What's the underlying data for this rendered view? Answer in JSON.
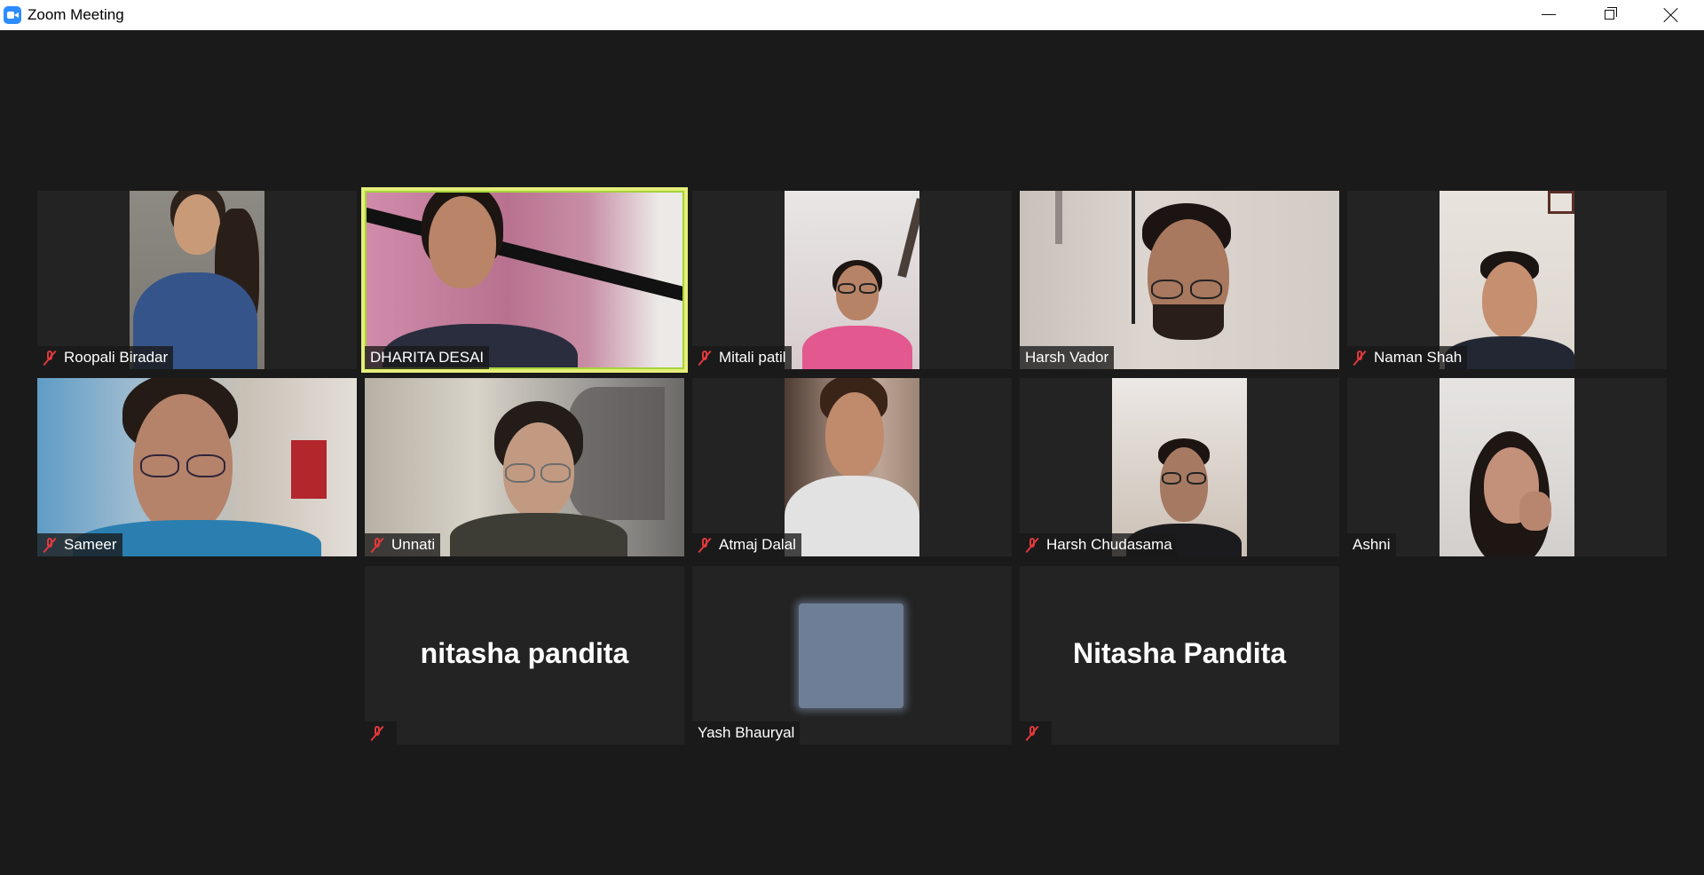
{
  "window": {
    "title": "Zoom Meeting"
  },
  "participants": [
    {
      "name": "Roopali Biradar",
      "muted": true
    },
    {
      "name": "DHARITA DESAI",
      "muted": false,
      "active_speaker": true
    },
    {
      "name": "Mitali patil",
      "muted": true
    },
    {
      "name": "Harsh Vador",
      "muted": false
    },
    {
      "name": "Naman Shah",
      "muted": true
    },
    {
      "name": "Sameer",
      "muted": true
    },
    {
      "name": "Unnati",
      "muted": true
    },
    {
      "name": "Atmaj Dalal",
      "muted": true
    },
    {
      "name": "Harsh Chudasama",
      "muted": true
    },
    {
      "name": "Ashni",
      "muted": false
    },
    {
      "display_name": "nitasha pandita",
      "muted": true,
      "video": "off"
    },
    {
      "name": "Yash Bhauryal",
      "muted": false,
      "video": "off"
    },
    {
      "display_name": "Nitasha Pandita",
      "muted": true,
      "video": "off"
    }
  ],
  "colors": {
    "background": "#1a1a1a",
    "tile": "#232323",
    "active_speaker_border": "#e5ef7a",
    "muted_icon": "#e0393b"
  },
  "icons": [
    "zoom-app-icon",
    "minimize-icon",
    "restore-icon",
    "close-icon",
    "muted-mic-icon"
  ]
}
